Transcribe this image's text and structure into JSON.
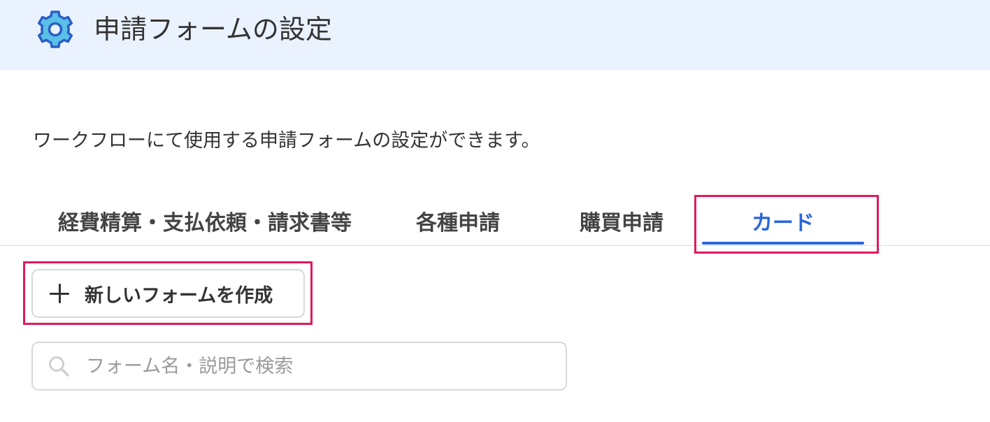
{
  "header": {
    "title": "申請フォームの設定",
    "icon": "gear-icon",
    "background_color": "#eaf2fe",
    "icon_color": "#5bc0e8"
  },
  "description": "ワークフローにて使用する申請フォームの設定ができます。",
  "tabs": [
    {
      "label": "経費精算・支払依頼・請求書等",
      "active": false
    },
    {
      "label": "各種申請",
      "active": false
    },
    {
      "label": "購買申請",
      "active": false
    },
    {
      "label": "カード",
      "active": true
    }
  ],
  "accent_color": "#2b65d9",
  "highlight_color": "#e0195f",
  "create_button": {
    "label": "新しいフォームを作成",
    "icon": "plus-icon"
  },
  "search": {
    "placeholder": "フォーム名・説明で検索",
    "value": "",
    "icon": "search-icon"
  }
}
